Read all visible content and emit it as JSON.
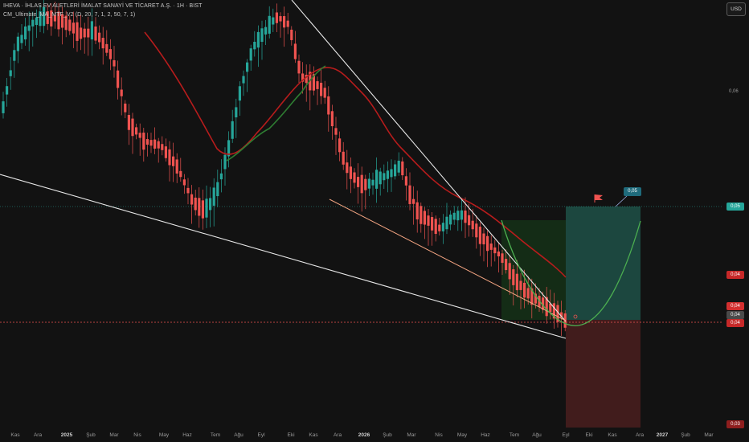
{
  "header": {
    "title": "IHEVA · İHLAS EV ALETLERİ İMALAT SANAYİ VE TİCARET A.Ş. · 1H · BIST",
    "indicator": "CM_Ultimate_MA_MTF_V2 (D, 20, 7, 1, 2, 50, 7, 1)"
  },
  "currency_button": "USD",
  "price_axis": {
    "label_006": "0,06",
    "tag_green": "0,05",
    "tag_red": "0,04",
    "tag_gray1": "0,04",
    "tag_gray2": "0,04",
    "tag_red2": "0,04",
    "tag_bottom": "0,03",
    "callout": "0,05"
  },
  "colors": {
    "up": "#26a69a",
    "down": "#ef5350",
    "ma_red": "#b71c1c",
    "ma_green": "#2e7d32",
    "trend": "#e8e8e8",
    "target_tag": "#1f6b7c"
  },
  "chart_data": {
    "type": "candlestick",
    "x_tick_labels": [
      "Kas",
      "Ara",
      "2025",
      "Şub",
      "Mar",
      "Nis",
      "May",
      "Haz",
      "Tem",
      "Ağu",
      "Eyl",
      "Eki",
      "Kas",
      "Ara",
      "2026",
      "Şub",
      "Mar",
      "Nis",
      "May",
      "Haz",
      "Tem",
      "Ağu",
      "Eyl",
      "Eki",
      "Kas",
      "Ara",
      "2027",
      "Şub",
      "Mar"
    ],
    "bold_ticks": [
      "2025",
      "2026",
      "2027"
    ],
    "y_labels": [
      "0,06",
      "0,05",
      "0,04",
      "0,03"
    ],
    "annotations": [
      "0,05"
    ]
  }
}
